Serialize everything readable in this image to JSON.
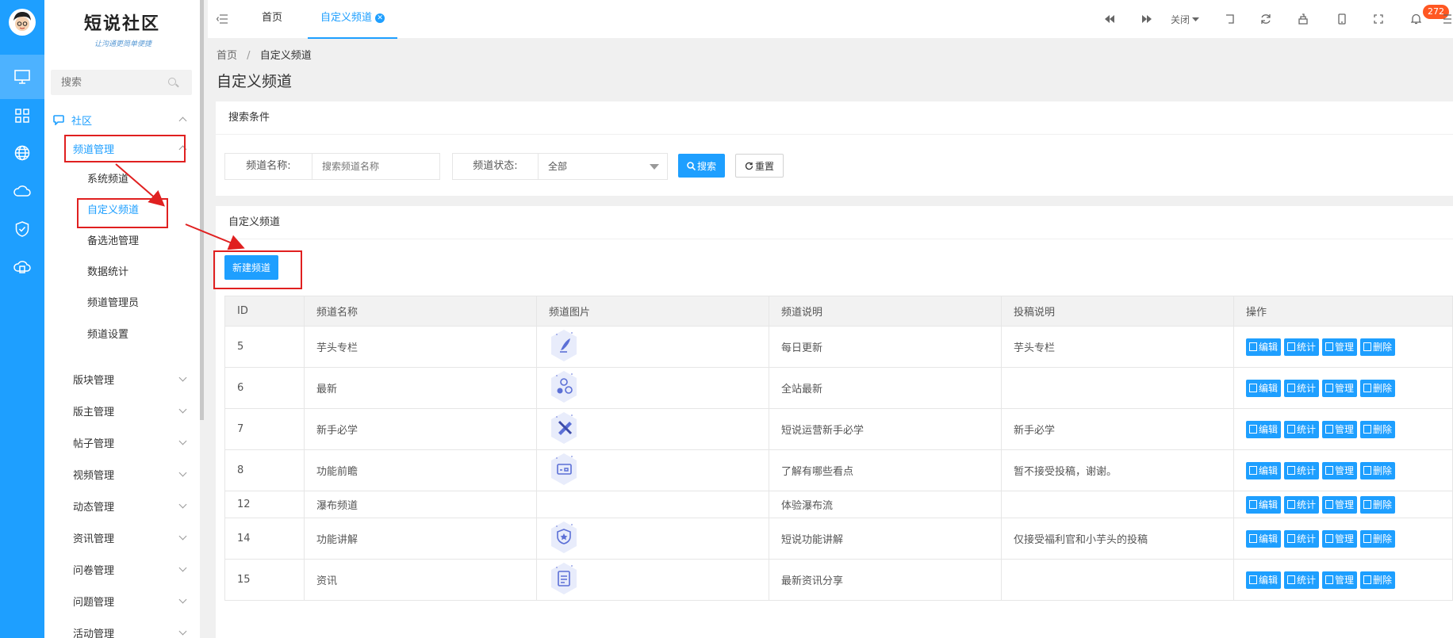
{
  "brand": {
    "title": "短说社区",
    "slogan": "让沟通更简单便捷"
  },
  "sidebar": {
    "search_placeholder": "搜索",
    "community_label": "社区",
    "channel_mgmt_label": "频道管理",
    "channel_sub": [
      "系统频道",
      "自定义频道",
      "备选池管理",
      "数据统计",
      "频道管理员",
      "频道设置"
    ],
    "modules": [
      "版块管理",
      "版主管理",
      "帖子管理",
      "视频管理",
      "动态管理",
      "资讯管理",
      "问卷管理",
      "问题管理",
      "活动管理"
    ]
  },
  "topbar": {
    "tabs": [
      "首页",
      "自定义频道"
    ],
    "close_label": "关闭",
    "badge_count": "272"
  },
  "breadcrumb": {
    "home": "首页",
    "sep": "/",
    "current": "自定义频道"
  },
  "page_title": "自定义频道",
  "search_panel": {
    "header": "搜索条件",
    "name_label": "频道名称:",
    "name_placeholder": "搜索频道名称",
    "status_label": "频道状态:",
    "status_value": "全部",
    "search_btn": "搜索",
    "reset_btn": "重置"
  },
  "list_panel": {
    "header": "自定义频道",
    "new_btn": "新建频道",
    "columns": [
      "ID",
      "频道名称",
      "频道图片",
      "频道说明",
      "投稿说明",
      "操作"
    ],
    "op_labels": [
      "编辑",
      "统计",
      "管理",
      "删除"
    ],
    "rows": [
      {
        "id": "5",
        "name": "芋头专栏",
        "image": "feather-pen-icon",
        "desc": "每日更新",
        "submit": "芋头专栏"
      },
      {
        "id": "6",
        "name": "最新",
        "image": "molecule-icon",
        "desc": "全站最新",
        "submit": ""
      },
      {
        "id": "7",
        "name": "新手必学",
        "image": "pencil-ruler-icon",
        "desc": "短说运营新手必学",
        "submit": "新手必学"
      },
      {
        "id": "8",
        "name": "功能前瞻",
        "image": "screen-icon",
        "desc": "了解有哪些看点",
        "submit": "暂不接受投稿，谢谢。"
      },
      {
        "id": "12",
        "name": "瀑布频道",
        "image": "",
        "desc": "体验瀑布流",
        "submit": ""
      },
      {
        "id": "14",
        "name": "功能讲解",
        "image": "shield-star-icon",
        "desc": "短说功能讲解",
        "submit": "仅接受福利官和小芋头的投稿"
      },
      {
        "id": "15",
        "name": "资讯",
        "image": "document-icon",
        "desc": "最新资讯分享",
        "submit": ""
      }
    ]
  },
  "colors": {
    "primary": "#1e9fff",
    "rail": "#1e9fff",
    "highlight": "#e02020",
    "badge": "#ff5722"
  }
}
